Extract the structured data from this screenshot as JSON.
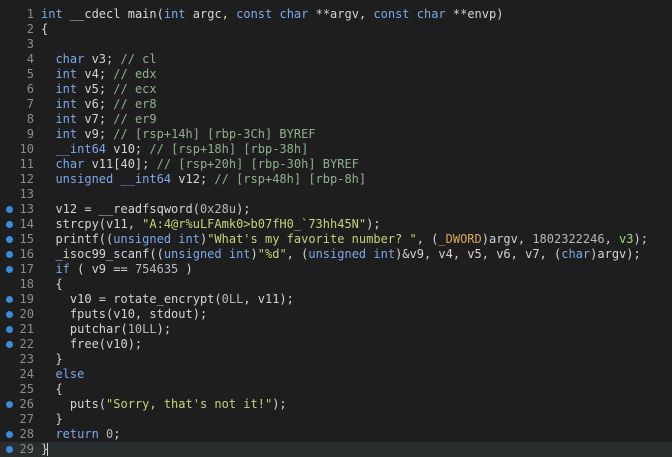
{
  "colors": {
    "background": "#1e1e1e",
    "current_line": "#2a2d2e",
    "breakpoint_dot": "#3a8ddc",
    "line_number": "#8c8c8c",
    "keyword": "#7fa7e6",
    "comment": "#8fb08f",
    "string": "#c8d27a",
    "identifier": "#d4d4d4"
  },
  "lines": [
    {
      "num": "1",
      "dot": false,
      "tokens": [
        [
          "kw",
          "int"
        ],
        [
          "id",
          " __cdecl "
        ],
        [
          "fn",
          "main"
        ],
        [
          "punc",
          "("
        ],
        [
          "kw",
          "int"
        ],
        [
          "id",
          " argc, "
        ],
        [
          "kw",
          "const char"
        ],
        [
          "id",
          " **argv, "
        ],
        [
          "kw",
          "const char"
        ],
        [
          "id",
          " **envp)"
        ]
      ]
    },
    {
      "num": "2",
      "dot": false,
      "tokens": [
        [
          "punc",
          "{"
        ]
      ]
    },
    {
      "num": "3",
      "dot": false,
      "tokens": []
    },
    {
      "num": "4",
      "dot": false,
      "tokens": [
        [
          "id",
          "  "
        ],
        [
          "kw",
          "char"
        ],
        [
          "id",
          " v3; "
        ],
        [
          "cmt",
          "// cl"
        ]
      ]
    },
    {
      "num": "5",
      "dot": false,
      "tokens": [
        [
          "id",
          "  "
        ],
        [
          "kw",
          "int"
        ],
        [
          "id",
          " v4; "
        ],
        [
          "cmt",
          "// edx"
        ]
      ]
    },
    {
      "num": "6",
      "dot": false,
      "tokens": [
        [
          "id",
          "  "
        ],
        [
          "kw",
          "int"
        ],
        [
          "id",
          " v5; "
        ],
        [
          "cmt",
          "// ecx"
        ]
      ]
    },
    {
      "num": "7",
      "dot": false,
      "tokens": [
        [
          "id",
          "  "
        ],
        [
          "kw",
          "int"
        ],
        [
          "id",
          " v6; "
        ],
        [
          "cmt",
          "// er8"
        ]
      ]
    },
    {
      "num": "8",
      "dot": false,
      "tokens": [
        [
          "id",
          "  "
        ],
        [
          "kw",
          "int"
        ],
        [
          "id",
          " v7; "
        ],
        [
          "cmt",
          "// er9"
        ]
      ]
    },
    {
      "num": "9",
      "dot": false,
      "tokens": [
        [
          "id",
          "  "
        ],
        [
          "kw",
          "int"
        ],
        [
          "id",
          " v9; "
        ],
        [
          "cmt",
          "// [rsp+14h] [rbp-3Ch] BYREF"
        ]
      ]
    },
    {
      "num": "10",
      "dot": false,
      "tokens": [
        [
          "id",
          "  "
        ],
        [
          "kw",
          "__int64"
        ],
        [
          "id",
          " v10; "
        ],
        [
          "cmt",
          "// [rsp+18h] [rbp-38h]"
        ]
      ]
    },
    {
      "num": "11",
      "dot": false,
      "tokens": [
        [
          "id",
          "  "
        ],
        [
          "kw",
          "char"
        ],
        [
          "id",
          " v11[40]; "
        ],
        [
          "cmt",
          "// [rsp+20h] [rbp-30h] BYREF"
        ]
      ]
    },
    {
      "num": "12",
      "dot": false,
      "tokens": [
        [
          "id",
          "  "
        ],
        [
          "kw",
          "unsigned __int64"
        ],
        [
          "id",
          " v12; "
        ],
        [
          "cmt",
          "// [rsp+48h] [rbp-8h]"
        ]
      ]
    },
    {
      "num": "13",
      "dot": false,
      "tokens": []
    },
    {
      "num": "13",
      "dot": true,
      "tokens": [
        [
          "id",
          "  v12 = __readfsqword("
        ],
        [
          "num",
          "0x28u"
        ],
        [
          "id",
          ");"
        ]
      ]
    },
    {
      "num": "14",
      "dot": true,
      "tokens": [
        [
          "id",
          "  strcpy(v11, "
        ],
        [
          "str",
          "\"A:4@r%uLFAmk0>b07fH0_`73hh45N\""
        ],
        [
          "id",
          ");"
        ]
      ]
    },
    {
      "num": "15",
      "dot": true,
      "tokens": [
        [
          "id",
          "  printf(("
        ],
        [
          "kw",
          "unsigned int"
        ],
        [
          "id",
          ")"
        ],
        [
          "str",
          "\"What's my favorite number? \""
        ],
        [
          "id",
          ", ("
        ],
        [
          "type",
          "_DWORD"
        ],
        [
          "id",
          ")argv, "
        ],
        [
          "num",
          "1802322246"
        ],
        [
          "id",
          ", "
        ],
        [
          "var",
          "v3"
        ],
        [
          "id",
          ");"
        ]
      ]
    },
    {
      "num": "16",
      "dot": true,
      "tokens": [
        [
          "id",
          "  _isoc99_scanf(("
        ],
        [
          "kw",
          "unsigned int"
        ],
        [
          "id",
          ")"
        ],
        [
          "str",
          "\"%d\""
        ],
        [
          "id",
          ", ("
        ],
        [
          "kw",
          "unsigned int"
        ],
        [
          "id",
          ")&v9, v4, v5, v6, v7, ("
        ],
        [
          "kw",
          "char"
        ],
        [
          "id",
          ")argv);"
        ]
      ]
    },
    {
      "num": "17",
      "dot": true,
      "tokens": [
        [
          "id",
          "  "
        ],
        [
          "kw",
          "if"
        ],
        [
          "id",
          " ( v9 == "
        ],
        [
          "num",
          "754635"
        ],
        [
          "id",
          " )"
        ]
      ]
    },
    {
      "num": "18",
      "dot": false,
      "tokens": [
        [
          "id",
          "  {"
        ]
      ]
    },
    {
      "num": "19",
      "dot": true,
      "tokens": [
        [
          "id",
          "    v10 = rotate_encrypt("
        ],
        [
          "num",
          "0LL"
        ],
        [
          "id",
          ", v11);"
        ]
      ]
    },
    {
      "num": "20",
      "dot": true,
      "tokens": [
        [
          "id",
          "    fputs(v10, stdout);"
        ]
      ]
    },
    {
      "num": "21",
      "dot": true,
      "tokens": [
        [
          "id",
          "    putchar("
        ],
        [
          "num",
          "10LL"
        ],
        [
          "id",
          ");"
        ]
      ]
    },
    {
      "num": "22",
      "dot": true,
      "tokens": [
        [
          "id",
          "    free(v10);"
        ]
      ]
    },
    {
      "num": "23",
      "dot": false,
      "tokens": [
        [
          "id",
          "  }"
        ]
      ]
    },
    {
      "num": "24",
      "dot": false,
      "tokens": [
        [
          "id",
          "  "
        ],
        [
          "kw",
          "else"
        ]
      ]
    },
    {
      "num": "25",
      "dot": false,
      "tokens": [
        [
          "id",
          "  {"
        ]
      ]
    },
    {
      "num": "26",
      "dot": true,
      "tokens": [
        [
          "id",
          "    puts("
        ],
        [
          "str",
          "\"Sorry, that's not it!\""
        ],
        [
          "id",
          ");"
        ]
      ]
    },
    {
      "num": "27",
      "dot": false,
      "tokens": [
        [
          "id",
          "  }"
        ]
      ]
    },
    {
      "num": "28",
      "dot": true,
      "tokens": [
        [
          "id",
          "  "
        ],
        [
          "kw",
          "return"
        ],
        [
          "id",
          " "
        ],
        [
          "num",
          "0"
        ],
        [
          "id",
          ";"
        ]
      ]
    },
    {
      "num": "29",
      "dot": true,
      "tokens": [
        [
          "punc",
          "}"
        ]
      ],
      "current": true
    }
  ]
}
